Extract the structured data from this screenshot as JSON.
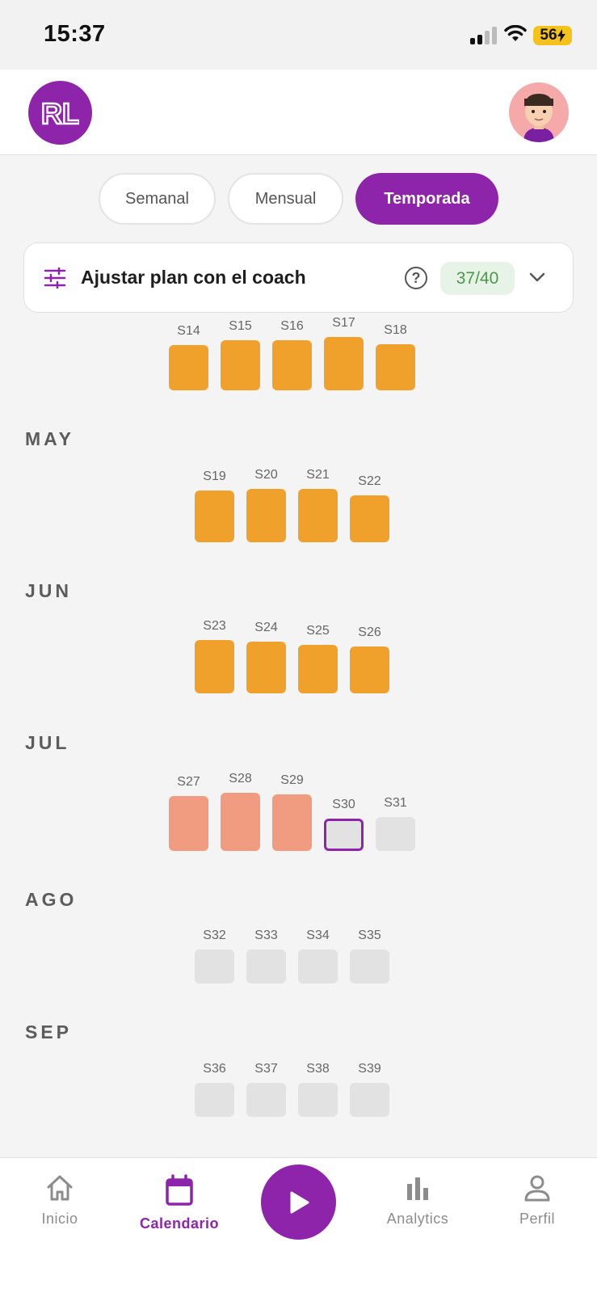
{
  "status_bar": {
    "time": "15:37",
    "battery": "56"
  },
  "header": {
    "logo_text": "RL"
  },
  "view_toggle": [
    {
      "label": "Semanal",
      "active": false
    },
    {
      "label": "Mensual",
      "active": false
    },
    {
      "label": "Temporada",
      "active": true
    }
  ],
  "coach_card": {
    "title": "Ajustar plan con el coach",
    "help": "?",
    "count": "37/40"
  },
  "calendar": {
    "months": [
      {
        "name": "",
        "weeks": [
          {
            "label": "S14",
            "status": "done"
          },
          {
            "label": "S15",
            "status": "done"
          },
          {
            "label": "S16",
            "status": "done"
          },
          {
            "label": "S17",
            "status": "done"
          },
          {
            "label": "S18",
            "status": "done"
          }
        ]
      },
      {
        "name": "MAY",
        "weeks": [
          {
            "label": "S19",
            "status": "done"
          },
          {
            "label": "S20",
            "status": "done"
          },
          {
            "label": "S21",
            "status": "done"
          },
          {
            "label": "S22",
            "status": "done"
          }
        ]
      },
      {
        "name": "JUN",
        "weeks": [
          {
            "label": "S23",
            "status": "done"
          },
          {
            "label": "S24",
            "status": "done"
          },
          {
            "label": "S25",
            "status": "done"
          },
          {
            "label": "S26",
            "status": "done"
          }
        ]
      },
      {
        "name": "JUL",
        "weeks": [
          {
            "label": "S27",
            "status": "partial"
          },
          {
            "label": "S28",
            "status": "partial"
          },
          {
            "label": "S29",
            "status": "partial"
          },
          {
            "label": "S30",
            "status": "current"
          },
          {
            "label": "S31",
            "status": "future"
          }
        ]
      },
      {
        "name": "AGO",
        "weeks": [
          {
            "label": "S32",
            "status": "future"
          },
          {
            "label": "S33",
            "status": "future"
          },
          {
            "label": "S34",
            "status": "future"
          },
          {
            "label": "S35",
            "status": "future"
          }
        ]
      },
      {
        "name": "SEP",
        "weeks": [
          {
            "label": "S36",
            "status": "future"
          },
          {
            "label": "S37",
            "status": "future"
          },
          {
            "label": "S38",
            "status": "future"
          },
          {
            "label": "S39",
            "status": "future"
          }
        ]
      }
    ]
  },
  "nav": {
    "items": [
      {
        "label": "Inicio",
        "icon": "home-icon",
        "active": false
      },
      {
        "label": "Calendario",
        "icon": "calendar-icon",
        "active": true
      },
      {
        "label": "Analytics",
        "icon": "bar-chart-icon",
        "active": false
      },
      {
        "label": "Perfil",
        "icon": "user-icon",
        "active": false
      }
    ],
    "play_icon": "play-icon"
  },
  "colors": {
    "brand": "#8e24aa",
    "done": "#f0a12b",
    "partial": "#f19c80",
    "future": "#e2e2e2",
    "badge_text": "#4a9a4a"
  }
}
